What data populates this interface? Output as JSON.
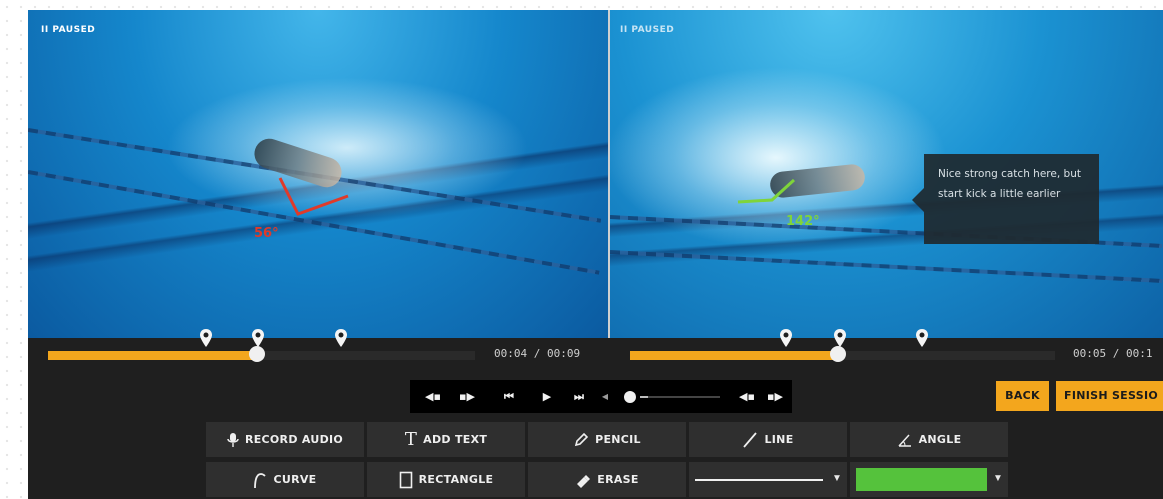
{
  "left_video": {
    "status": "II PAUSED",
    "angle": "56°",
    "angle_color": "#e03a2a",
    "timecode": "00:04 / 00:09",
    "progress": 0.49
  },
  "right_video": {
    "status": "II PAUSED",
    "angle": "142°",
    "angle_color": "#7fd43a",
    "timecode": "00:05 / 00:1",
    "progress": 0.49,
    "comment": "Nice strong catch here, but start kick a little earlier"
  },
  "transport": {
    "prev_marker": "◀▪",
    "next_marker": "▪▶",
    "skip_back": "⏮",
    "play": "▶",
    "skip_forward": "⏭",
    "volume_icon": "◀",
    "volume": 0.1
  },
  "actions": {
    "back": "BACK",
    "finish": "FINISH SESSIO"
  },
  "tools": {
    "record_audio": "RECORD AUDIO",
    "add_text": "ADD TEXT",
    "pencil": "PENCIL",
    "line": "LINE",
    "angle": "ANGLE",
    "curve": "CURVE",
    "rectangle": "RECTANGLE",
    "erase": "ERASE"
  },
  "style": {
    "selected_color": "#55c23c",
    "accent": "#f3a61d"
  }
}
